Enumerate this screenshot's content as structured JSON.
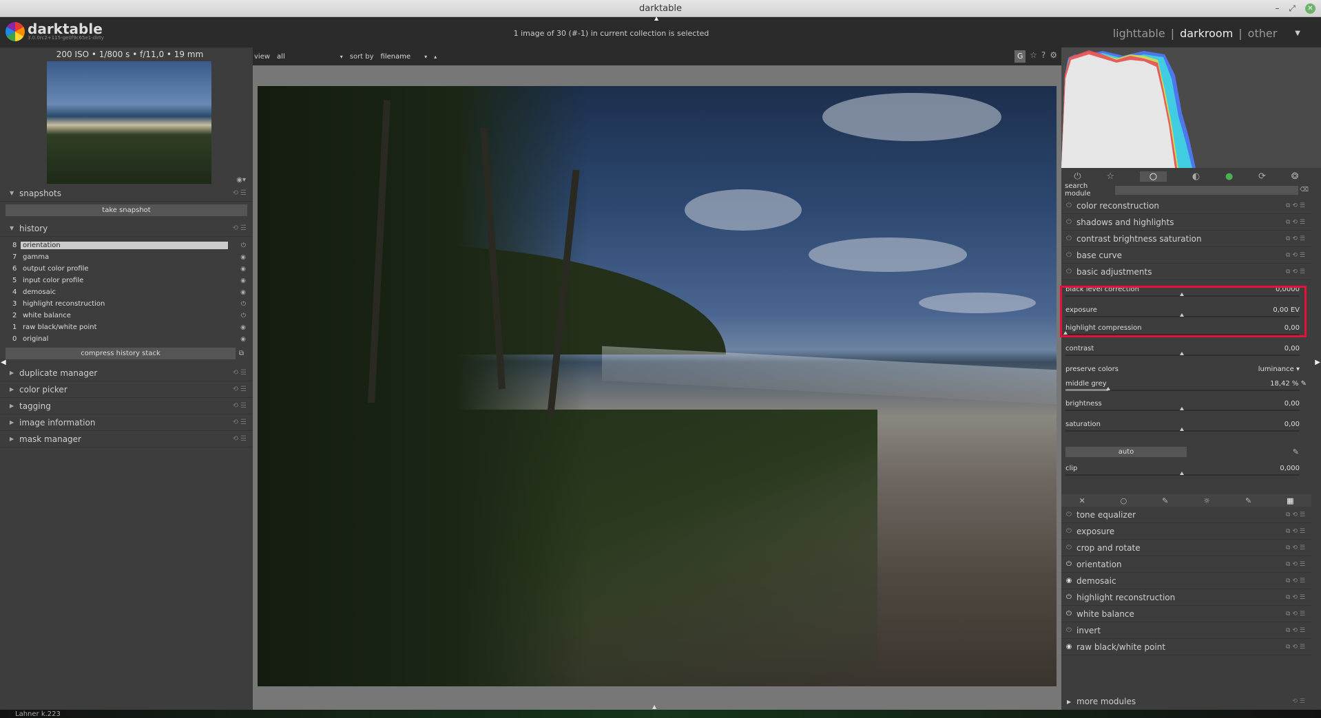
{
  "window": {
    "title": "darktable",
    "minimize": "–",
    "maximize": "⤢",
    "close": "✕"
  },
  "topbar": {
    "logo_name": "darktable",
    "logo_version": "3.0.0rc2+115-ge0f9c65e1-dirty",
    "collection_message": "1 image of 30 (#-1) in current collection is selected",
    "views": {
      "lighttable": "lighttable",
      "sep1": "|",
      "darkroom": "darkroom",
      "sep2": "|",
      "other": "other"
    },
    "active_view": "darkroom"
  },
  "left": {
    "exif": "200 ISO • 1/800 s • f/11,0 • 19 mm",
    "snapshots": {
      "title": "snapshots",
      "take_snapshot": "take snapshot"
    },
    "history": {
      "title": "history",
      "items": [
        {
          "num": "8",
          "label": "orientation",
          "selected": true
        },
        {
          "num": "7",
          "label": "gamma"
        },
        {
          "num": "6",
          "label": "output color profile"
        },
        {
          "num": "5",
          "label": "input color profile"
        },
        {
          "num": "4",
          "label": "demosaic"
        },
        {
          "num": "3",
          "label": "highlight reconstruction"
        },
        {
          "num": "2",
          "label": "white balance"
        },
        {
          "num": "1",
          "label": "raw black/white point"
        },
        {
          "num": "0",
          "label": "original"
        }
      ],
      "compress": "compress history stack"
    },
    "modules": [
      "duplicate manager",
      "color picker",
      "tagging",
      "image information",
      "mask manager"
    ]
  },
  "filterbar": {
    "view_label": "view",
    "view_value": "all",
    "sort_label": "sort by",
    "sort_value": "filename",
    "g_button": "G"
  },
  "right": {
    "search_label": "search module",
    "modules_top": [
      "color reconstruction",
      "shadows and highlights",
      "contrast brightness saturation",
      "base curve",
      "basic adjustments"
    ],
    "basic_adjustments": {
      "black_level_correction": {
        "label": "black level correction",
        "value": "0,0000"
      },
      "exposure": {
        "label": "exposure",
        "value": "0,00 EV"
      },
      "highlight_compression": {
        "label": "highlight compression",
        "value": "0,00"
      },
      "contrast": {
        "label": "contrast",
        "value": "0,00"
      },
      "preserve_colors": {
        "label": "preserve colors",
        "value": "luminance"
      },
      "middle_grey": {
        "label": "middle grey",
        "value": "18,42 %"
      },
      "brightness": {
        "label": "brightness",
        "value": "0,00"
      },
      "saturation": {
        "label": "saturation",
        "value": "0,00"
      },
      "auto": "auto",
      "clip": {
        "label": "clip",
        "value": "0,000"
      }
    },
    "modules_bottom": [
      {
        "label": "tone equalizer",
        "on": false
      },
      {
        "label": "exposure",
        "on": false
      },
      {
        "label": "crop and rotate",
        "on": false
      },
      {
        "label": "orientation",
        "on": true
      },
      {
        "label": "demosaic",
        "on": true
      },
      {
        "label": "highlight reconstruction",
        "on": true
      },
      {
        "label": "white balance",
        "on": true
      },
      {
        "label": "invert",
        "on": false
      },
      {
        "label": "raw black/white point",
        "on": true
      }
    ],
    "more_modules": "more modules"
  },
  "bottom_text": "Lahner k.223",
  "colors": {
    "highlight_box": "#e8103a",
    "panel_bg": "#3d3d3d",
    "center_bg": "#777777"
  }
}
